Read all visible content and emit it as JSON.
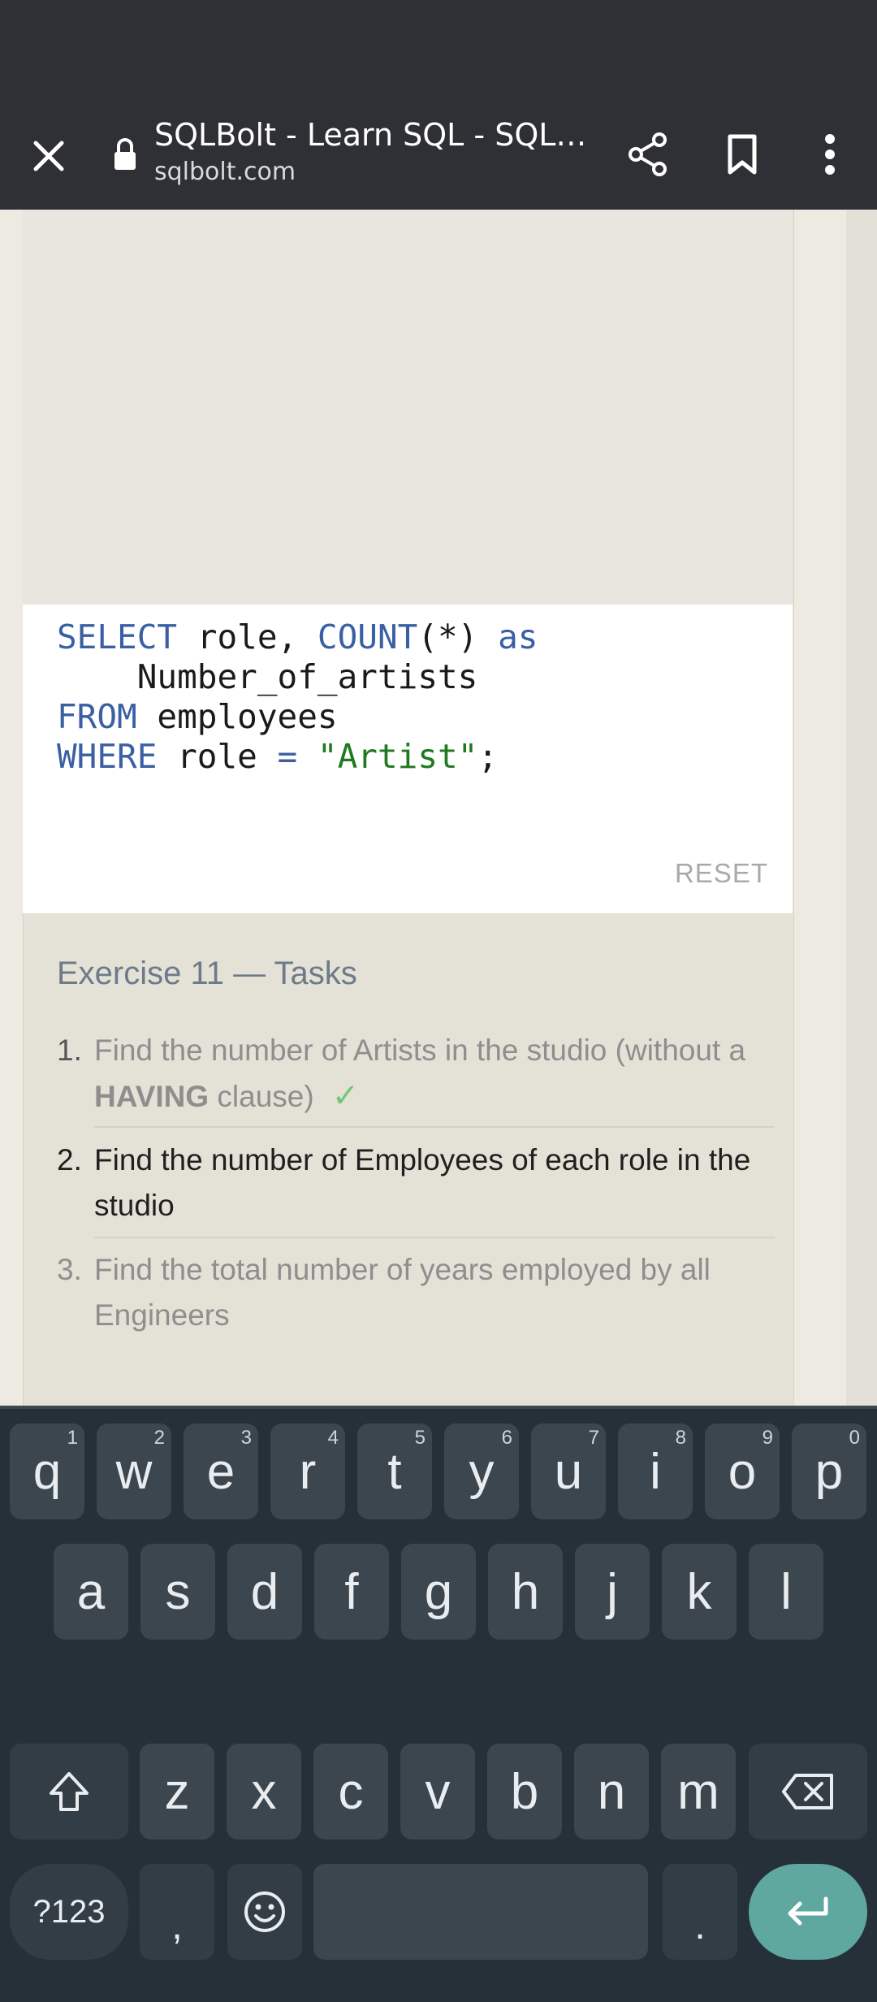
{
  "browser": {
    "title": "SQLBolt - Learn SQL - SQL L...",
    "url": "sqlbolt.com"
  },
  "editor": {
    "code_lines": [
      [
        {
          "t": "SELECT",
          "k": "kw"
        },
        {
          "t": " role, ",
          "k": ""
        },
        {
          "t": "COUNT",
          "k": "kw"
        },
        {
          "t": "(*) ",
          "k": ""
        },
        {
          "t": "as",
          "k": "kw"
        }
      ],
      [
        {
          "t": "    Number_of_artists",
          "k": ""
        }
      ],
      [
        {
          "t": "FROM",
          "k": "kw"
        },
        {
          "t": " employees",
          "k": ""
        }
      ],
      [
        {
          "t": "WHERE",
          "k": "kw"
        },
        {
          "t": " role ",
          "k": ""
        },
        {
          "t": "=",
          "k": "kw"
        },
        {
          "t": " ",
          "k": ""
        },
        {
          "t": "\"Artist\"",
          "k": "str"
        },
        {
          "t": ";",
          "k": ""
        }
      ]
    ],
    "reset_label": "RESET"
  },
  "tasks": {
    "title": "Exercise 11 — Tasks",
    "items": [
      {
        "num": "1.",
        "text_before": "Find the number of Artists in the studio (without a ",
        "bold": "HAVING",
        "text_after": " clause)",
        "check": "✓"
      },
      {
        "num": "2.",
        "text": "Find the number of Employees of each role in the studio"
      },
      {
        "num": "3.",
        "text": "Find the total number of years employed by all Engineers"
      }
    ]
  },
  "keyboard": {
    "row1": [
      {
        "label": "q",
        "hint": "1"
      },
      {
        "label": "w",
        "hint": "2"
      },
      {
        "label": "e",
        "hint": "3"
      },
      {
        "label": "r",
        "hint": "4"
      },
      {
        "label": "t",
        "hint": "5"
      },
      {
        "label": "y",
        "hint": "6"
      },
      {
        "label": "u",
        "hint": "7"
      },
      {
        "label": "i",
        "hint": "8"
      },
      {
        "label": "o",
        "hint": "9"
      },
      {
        "label": "p",
        "hint": "0"
      }
    ],
    "row2": [
      "a",
      "s",
      "d",
      "f",
      "g",
      "h",
      "j",
      "k",
      "l"
    ],
    "row3": [
      "z",
      "x",
      "c",
      "v",
      "b",
      "n",
      "m"
    ],
    "symbols_label": "?123",
    "comma_label": ",",
    "period_label": "."
  }
}
